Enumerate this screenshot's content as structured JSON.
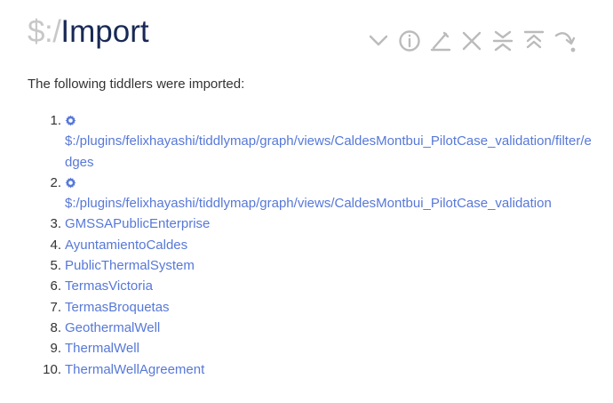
{
  "tiddler": {
    "title_prefix": "$:/",
    "title_main": "Import",
    "toolbar": [
      {
        "icon": "chevron-down-icon",
        "action": "fold"
      },
      {
        "icon": "info-icon",
        "action": "info"
      },
      {
        "icon": "edit-icon",
        "action": "edit"
      },
      {
        "icon": "close-icon",
        "action": "close"
      },
      {
        "icon": "close-others-icon",
        "action": "close-others"
      },
      {
        "icon": "fold-others-icon",
        "action": "fold-others"
      },
      {
        "icon": "more-icon",
        "action": "more"
      }
    ],
    "intro": "The following tiddlers were imported:",
    "imported": [
      {
        "number": "1.",
        "system": true,
        "title": "$:/plugins/felixhayashi/tiddlymap/graph/views/CaldesMontbui_PilotCase_validation/filter/edges"
      },
      {
        "number": "2.",
        "system": true,
        "title": "$:/plugins/felixhayashi/tiddlymap/graph/views/CaldesMontbui_PilotCase_validation"
      },
      {
        "number": "3.",
        "system": false,
        "title": "GMSSAPublicEnterprise"
      },
      {
        "number": "4.",
        "system": false,
        "title": "AyuntamientoCaldes"
      },
      {
        "number": "5.",
        "system": false,
        "title": "PublicThermalSystem"
      },
      {
        "number": "6.",
        "system": false,
        "title": "TermasVictoria"
      },
      {
        "number": "7.",
        "system": false,
        "title": "TermasBroquetas"
      },
      {
        "number": "8.",
        "system": false,
        "title": "GeothermalWell"
      },
      {
        "number": "9.",
        "system": false,
        "title": "ThermalWell"
      },
      {
        "number": "10.",
        "system": false,
        "title": "ThermalWellAgreement"
      }
    ]
  },
  "colors": {
    "title": "#182955",
    "title_prefix": "#c8c8c8",
    "link": "#5778d8",
    "toolbar_icon": "#bbbbbb"
  }
}
